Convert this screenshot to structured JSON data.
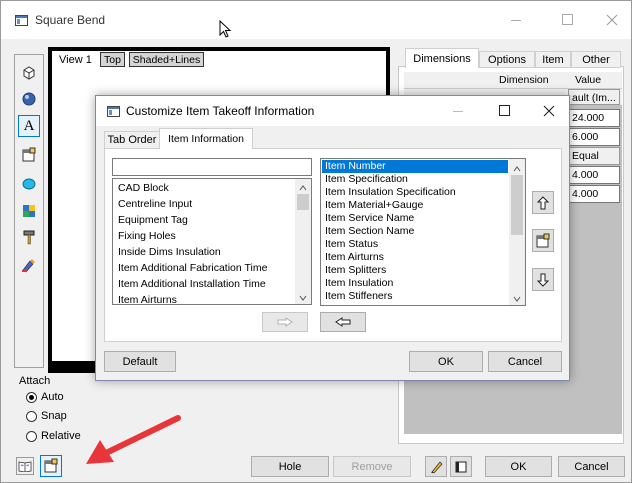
{
  "main_window": {
    "title": "Square Bend",
    "view_label": "View 1",
    "view_buttons": [
      "Top",
      "Shaded+Lines"
    ],
    "attach": {
      "label": "Attach",
      "options": [
        {
          "label": "Auto",
          "checked": true
        },
        {
          "label": "Snap",
          "checked": false
        },
        {
          "label": "Relative",
          "checked": false
        }
      ]
    },
    "tabs": [
      "Dimensions",
      "Options",
      "Item",
      "Other"
    ],
    "grid": {
      "headers": [
        "Dimension",
        "Value"
      ],
      "values": [
        "ault (Im...",
        "24.000",
        "6.000",
        "Equal",
        "4.000",
        "4.000"
      ]
    },
    "bottom_buttons": {
      "hole": "Hole",
      "remove": "Remove",
      "ok": "OK",
      "cancel": "Cancel"
    },
    "toolbar_icons": [
      "cube-icon",
      "sphere-icon",
      "text-a-icon",
      "properties-icon",
      "circle-icon",
      "grid-color-icon",
      "hammer-icon",
      "paint-icon"
    ]
  },
  "dialog": {
    "title": "Customize Item Takeoff Information",
    "tabs": [
      "Tab Order",
      "Item Information"
    ],
    "active_tab": "Item Information",
    "left_input_value": "",
    "left_list": [
      "CAD Block",
      "Centreline Input",
      "Equipment Tag",
      "Fixing Holes",
      "Inside Dims Insulation",
      "Item Additional Fabrication Time",
      "Item Additional Installation Time",
      "Item Airturns"
    ],
    "right_list": [
      "Item Number",
      "Item Specification",
      "Item Insulation Specification",
      "Item Material+Gauge",
      "Item Service Name",
      "Item Section Name",
      "Item Status",
      "Item Airturns",
      "Item Splitters",
      "Item Insulation",
      "Item Stiffeners"
    ],
    "selected_right": "Item Number",
    "buttons": {
      "default": "Default",
      "ok": "OK",
      "cancel": "Cancel"
    }
  },
  "colors": {
    "selection": "#0078d7",
    "annotation_arrow": "#e8353a"
  }
}
